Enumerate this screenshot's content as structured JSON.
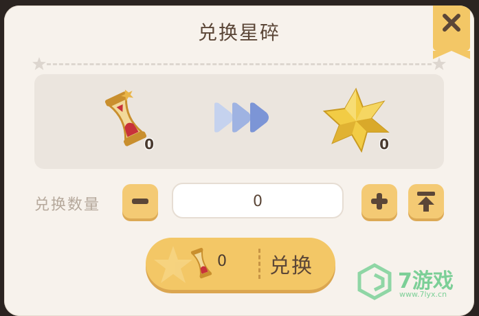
{
  "dialog": {
    "title": "兑换星碎"
  },
  "exchange": {
    "from_item": {
      "icon": "hourglass-icon",
      "count": "0"
    },
    "to_item": {
      "icon": "star-shard-icon",
      "count": "0"
    }
  },
  "quantity": {
    "label": "兑换数量",
    "value": "0",
    "decrease_icon": "minus-icon",
    "increase_icon": "plus-icon",
    "max_icon": "max-icon"
  },
  "confirm": {
    "cost_icon": "hourglass-icon",
    "cost_value": "0",
    "label": "兑换"
  },
  "watermark": {
    "brand": "7游戏",
    "url": "www.7lyx.cn"
  },
  "colors": {
    "panel_bg": "#f7f2ec",
    "accent_yellow": "#f3c766",
    "text_brown": "#5b4637",
    "arrow_blue": "#7c95d6"
  }
}
